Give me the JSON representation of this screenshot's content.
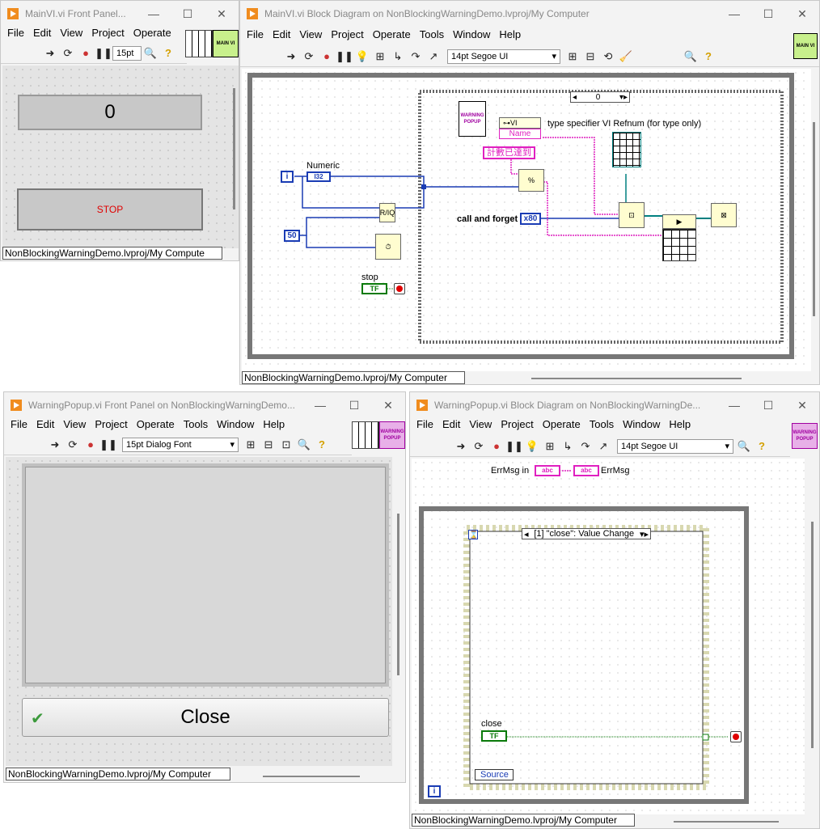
{
  "win1": {
    "title": "MainVI.vi Front Panel...",
    "menu": [
      "File",
      "Edit",
      "View",
      "Project",
      "Operate"
    ],
    "font": "15pt",
    "icon_text": "MAIN VI",
    "numeric_value": "0",
    "stop_label": "STOP",
    "status": "NonBlockingWarningDemo.lvproj/My Compute"
  },
  "win2": {
    "title": "MainVI.vi Block Diagram on NonBlockingWarningDemo.lvproj/My Computer",
    "menu": [
      "File",
      "Edit",
      "View",
      "Project",
      "Operate",
      "Tools",
      "Window",
      "Help"
    ],
    "font": "14pt Segoe UI",
    "icon_text": "MAIN VI",
    "case_selector": "0",
    "numeric_label": "Numeric",
    "numeric_type": "I32",
    "iter": "i",
    "const_50": "50",
    "stop_label": "stop",
    "tf": "TF",
    "warning_popup_text": "WARNING POPUP",
    "prop_vi": "VI",
    "prop_name": "Name",
    "type_spec_label": "type specifier VI Refnum (for type only)",
    "chinese_string": "計數已達到",
    "call_label": "call and forget",
    "call_value": "x80",
    "status": "NonBlockingWarningDemo.lvproj/My Computer"
  },
  "win3": {
    "title": "WarningPopup.vi Front Panel on NonBlockingWarningDemo...",
    "menu": [
      "File",
      "Edit",
      "View",
      "Project",
      "Operate",
      "Tools",
      "Window",
      "Help"
    ],
    "font": "15pt Dialog Font",
    "icon_text": "WARNING POPUP",
    "close_label": "Close",
    "status": "NonBlockingWarningDemo.lvproj/My Computer"
  },
  "win4": {
    "title": "WarningPopup.vi Block Diagram on NonBlockingWarningDe...",
    "menu": [
      "File",
      "Edit",
      "View",
      "Project",
      "Operate",
      "Tools",
      "Window",
      "Help"
    ],
    "font": "14pt Segoe UI",
    "icon_text": "WARNING POPUP",
    "errmsg_in_label": "ErrMsg  in",
    "errmsg_label": "ErrMsg",
    "abc": "abc",
    "event_selector": "[1] \"close\": Value Change",
    "close_label": "close",
    "tf": "TF",
    "source_label": "Source",
    "iter": "i",
    "status": "NonBlockingWarningDemo.lvproj/My Computer"
  },
  "colors": {
    "wire_blue": "#1a3cb4",
    "wire_pink": "#e020c0",
    "bool_green": "#0a7a0a",
    "accent_orange": "#f08c1e"
  }
}
